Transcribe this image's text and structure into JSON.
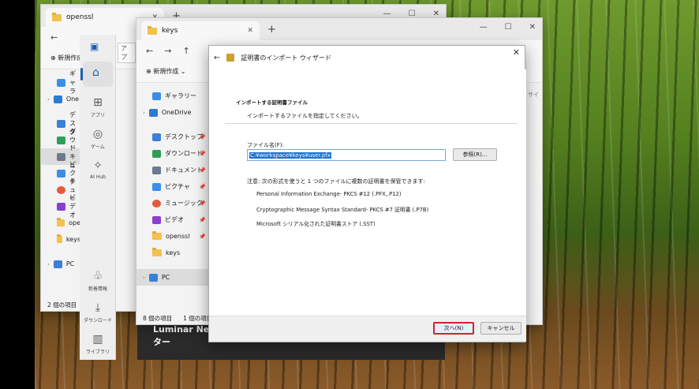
{
  "windows": {
    "back": {
      "tab_title": "openssl",
      "cmd_new": "新規作成",
      "status": "2 個の項目",
      "side_items": [
        "ギャラ",
        "One",
        "デスク",
        "ダウン",
        "ドキュ",
        "ピクチ",
        "ミュー",
        "ビデオ",
        "ope",
        "keys",
        "PC"
      ]
    },
    "mid": {
      "tab_title": "keys",
      "cmd_new": "新規作成",
      "status_left": "8 個の項目",
      "status_right": "1 個の項目",
      "side_items": [
        {
          "label": "ギャラリー",
          "color": "#3a8ee6"
        },
        {
          "label": "OneDrive",
          "color": "#2b7cd3"
        },
        {
          "label": "デスクトップ",
          "color": "#3b7fd9"
        },
        {
          "label": "ダウンロード",
          "color": "#2e9e57"
        },
        {
          "label": "ドキュメント",
          "color": "#6b7a8f"
        },
        {
          "label": "ピクチャ",
          "color": "#3c8ee8"
        },
        {
          "label": "ミュージック",
          "color": "#e35b3b"
        },
        {
          "label": "ビデオ",
          "color": "#8a3fd1"
        },
        {
          "label": "openssl",
          "color": "#f2c14e"
        },
        {
          "label": "keys",
          "color": "#f2c14e"
        },
        {
          "label": "PC",
          "color": "#3b7fd9"
        }
      ]
    }
  },
  "apppane": {
    "apps": "アプリ",
    "game": "ゲーム",
    "aihub": "AI Hub",
    "news": "新着情報",
    "download": "ダウンロード",
    "library": "ライブラリ"
  },
  "dialog": {
    "title": "証明書のインポート ウィザード",
    "section_title": "インポートする証明書ファイル",
    "section_desc": "インポートするファイルを指定してください。",
    "filename_label": "ファイル名(F):",
    "filename_value": "C:¥workspace¥keys¥user.pfx",
    "browse_label": "参照(R)...",
    "note": "注意: 次の形式を使うと 1 つのファイルに複数の証明書を保管できます:",
    "formats": [
      "Personal Information Exchange- PKCS #12 (.PFX,.P12)",
      "Cryptographic Message Syntax Standard- PKCS #7 証明書 (.P7B)",
      "Microsoft シリアル化された証明書ストア (.SST)"
    ],
    "next_label": "次へ(N)",
    "cancel_label": "キャンセル"
  },
  "thumbs": {
    "title_line1": "Luminar Ne",
    "title_line2": "ター"
  },
  "peek": {
    "address_fragment": "アプ",
    "search_fragment": "サイ"
  }
}
